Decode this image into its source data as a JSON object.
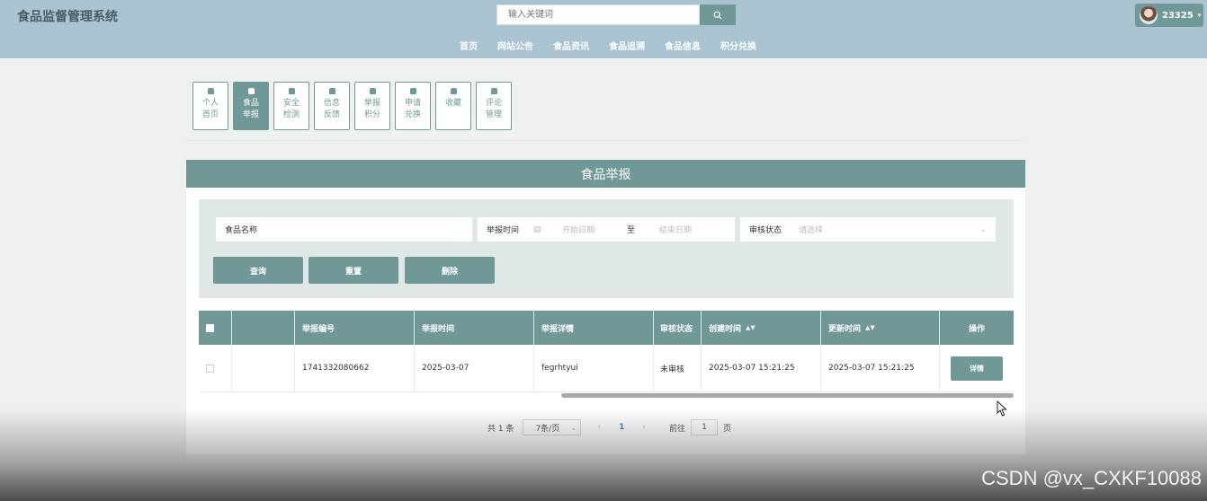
{
  "header": {
    "logo": "食品监督管理系统",
    "search_placeholder": "输入关键词",
    "nav": [
      "首页",
      "网站公告",
      "食品资讯",
      "食品追溯",
      "食品信息",
      "积分兑换"
    ],
    "user_name": "23325"
  },
  "tabs": [
    {
      "label": "个人首页",
      "active": false
    },
    {
      "label": "食品举报",
      "active": true
    },
    {
      "label": "安全检测",
      "active": false
    },
    {
      "label": "信息反馈",
      "active": false
    },
    {
      "label": "举报积分",
      "active": false
    },
    {
      "label": "申请兑换",
      "active": false
    },
    {
      "label": "收藏",
      "active": false
    },
    {
      "label": "评论管理",
      "active": false
    }
  ],
  "panel": {
    "title": "食品举报",
    "filter": {
      "name_placeholder": "食品名称",
      "time_label": "举报时间",
      "start_placeholder": "开始日期",
      "range_sep": "至",
      "end_placeholder": "结束日期",
      "status_label": "审核状态",
      "status_placeholder": "请选择",
      "buttons": {
        "search": "查询",
        "reset": "重置",
        "delete": "删除"
      }
    },
    "table": {
      "headers": [
        "举报编号",
        "举报时间",
        "举报详情",
        "审核状态",
        "创建时间",
        "更新时间",
        "操作"
      ],
      "rows": [
        {
          "report_no": "1741332080662",
          "report_time": "2025-03-07",
          "detail": "fegrhtyui",
          "status": "未审核",
          "created": "2025-03-07 15:21:25",
          "updated": "2025-03-07 15:21:25",
          "action": "详情"
        }
      ]
    },
    "pager": {
      "total": "共 1 条",
      "page_size": "7条/页",
      "current_page": "1",
      "goto_label": "前往",
      "goto_value": "1",
      "page_suffix": "页"
    }
  },
  "watermark": "CSDN @vx_CXKF10088",
  "colors": {
    "header_bg": "#a9c3d0",
    "accent": "#6f9896",
    "filter_bg": "#dfe7e7",
    "page_link": "#3a8ccf"
  }
}
